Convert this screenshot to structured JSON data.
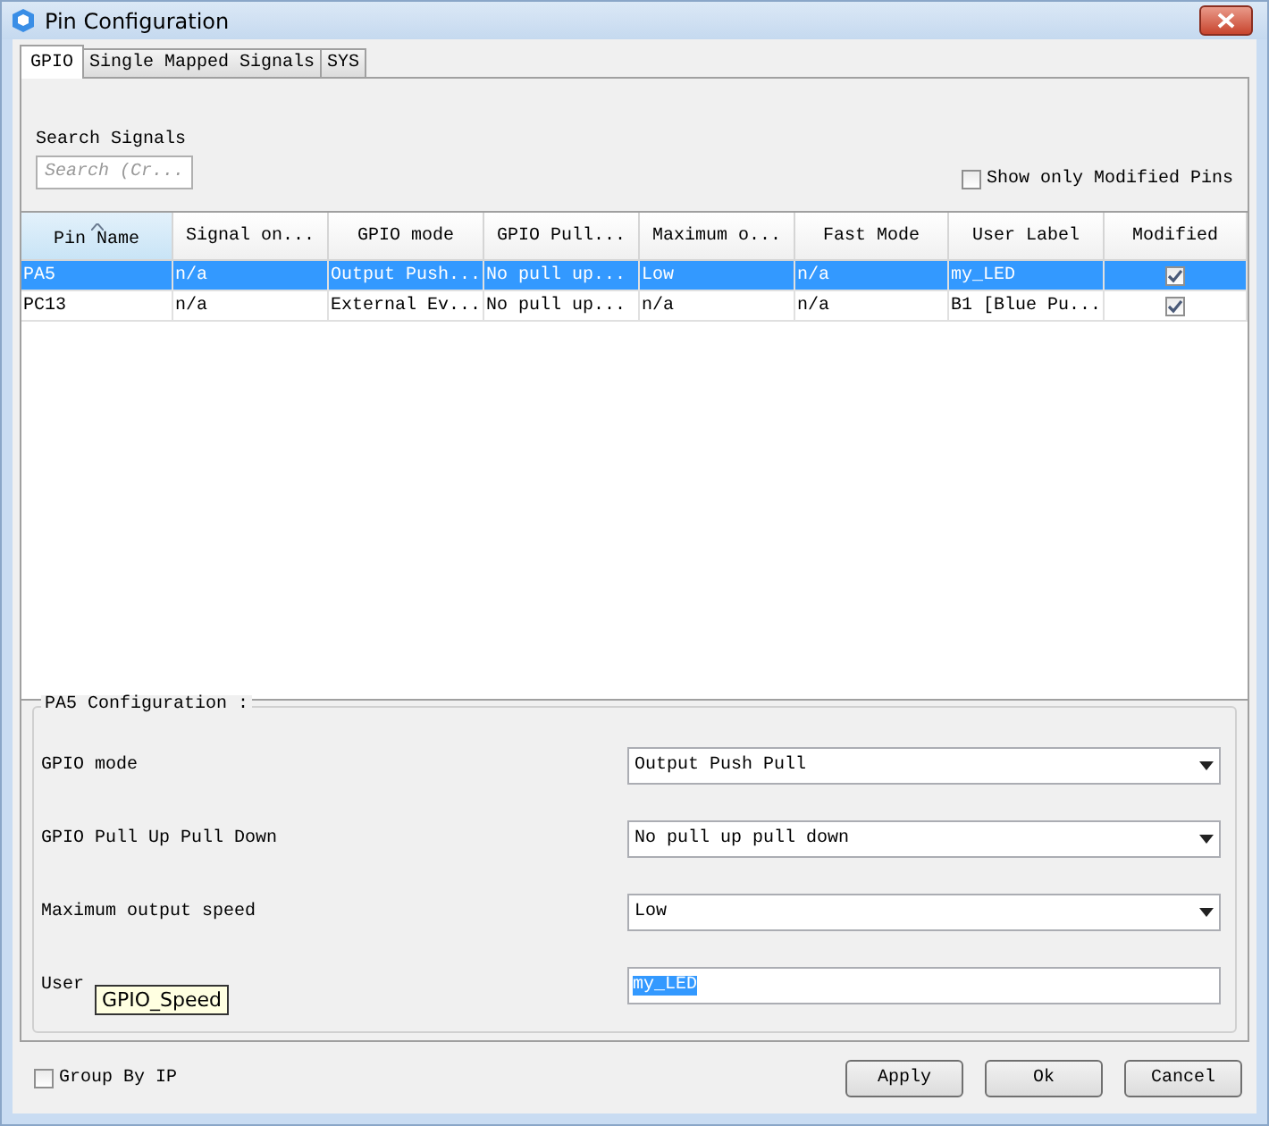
{
  "window": {
    "title": "Pin Configuration"
  },
  "tabs": [
    {
      "label": "GPIO",
      "selected": true
    },
    {
      "label": "Single Mapped Signals",
      "selected": false
    },
    {
      "label": "SYS",
      "selected": false
    }
  ],
  "search": {
    "label": "Search Signals",
    "placeholder": "Search (Cr..."
  },
  "show_only_modified": {
    "label": "Show only Modified Pins",
    "checked": false
  },
  "table": {
    "columns": [
      {
        "label": "Pin Name",
        "sorted": true
      },
      {
        "label": "Signal on...",
        "sorted": false
      },
      {
        "label": "GPIO mode",
        "sorted": false
      },
      {
        "label": "GPIO Pull...",
        "sorted": false
      },
      {
        "label": "Maximum o...",
        "sorted": false
      },
      {
        "label": "Fast Mode",
        "sorted": false
      },
      {
        "label": "User Label",
        "sorted": false
      },
      {
        "label": "Modified",
        "sorted": false
      }
    ],
    "rows": [
      {
        "cells": [
          "PA5",
          "n/a",
          "Output Push...",
          "No pull up...",
          "Low",
          "n/a",
          "my_LED"
        ],
        "modified": true,
        "selected": true
      },
      {
        "cells": [
          "PC13",
          "n/a",
          "External Ev...",
          "No pull up...",
          "n/a",
          "n/a",
          "B1 [Blue Pu..."
        ],
        "modified": true,
        "selected": false
      }
    ]
  },
  "config": {
    "title": "PA5 Configuration :",
    "fields": [
      {
        "label": "GPIO mode",
        "kind": "dropdown",
        "value": "Output Push Pull"
      },
      {
        "label": "GPIO Pull Up Pull Down",
        "kind": "dropdown",
        "value": "No pull up pull down"
      },
      {
        "label": "Maximum output speed",
        "kind": "dropdown",
        "value": "Low"
      },
      {
        "label": "User",
        "kind": "text",
        "value": "my_LED",
        "highlighted": true
      }
    ]
  },
  "tooltip": {
    "text": "GPIO_Speed"
  },
  "group_by_ip": {
    "label": "Group By IP",
    "checked": false
  },
  "buttons": [
    "Apply",
    "Ok",
    "Cancel"
  ]
}
